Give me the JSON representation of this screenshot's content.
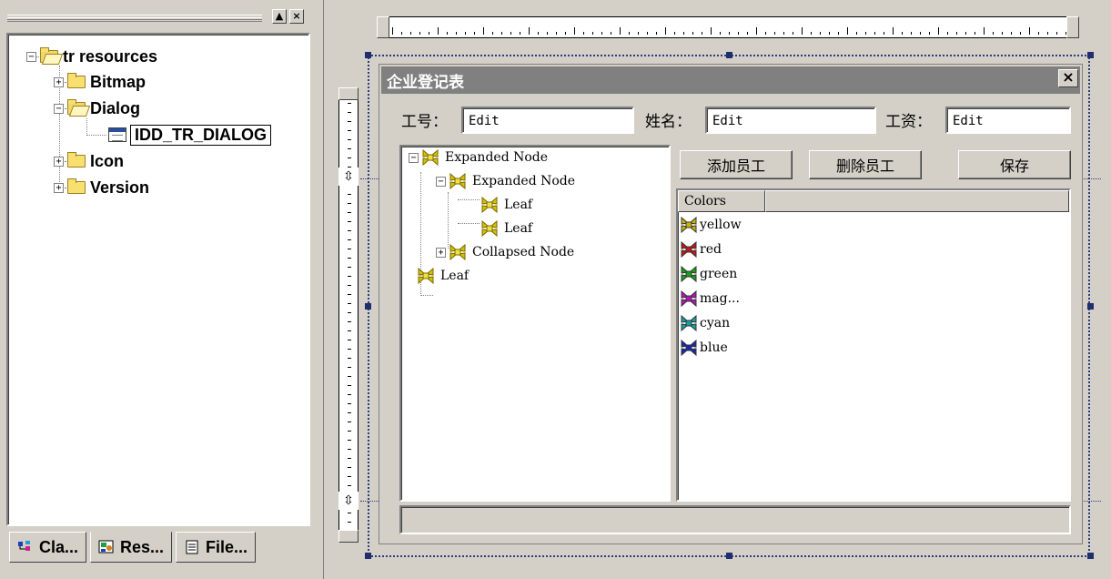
{
  "left_panel": {
    "minimize_glyph": "▲",
    "close_glyph": "×",
    "tree": {
      "root_label": "tr resources",
      "bitmap_label": "Bitmap",
      "dialog_label": "Dialog",
      "dialog_item_label": "IDD_TR_DIALOG",
      "icon_label": "Icon",
      "version_label": "Version",
      "expanded_glyph": "−",
      "collapsed_glyph": "+"
    },
    "tabs": [
      {
        "label": "Cla...",
        "icon": "class-view-icon"
      },
      {
        "label": "Res...",
        "icon": "resource-view-icon"
      },
      {
        "label": "File...",
        "icon": "file-view-icon"
      }
    ]
  },
  "dialog": {
    "title": "企业登记表",
    "close_glyph": "×",
    "fields": {
      "id_label": "工号：",
      "id_value": "Edit",
      "name_label": "姓名：",
      "name_value": "Edit",
      "salary_label": "工资：",
      "salary_value": "Edit"
    },
    "buttons": {
      "add": "添加员工",
      "delete": "删除员工",
      "save": "保存"
    },
    "tree_control": {
      "node1": "Expanded Node",
      "node2": "Expanded Node",
      "leaf1": "Leaf",
      "leaf2": "Leaf",
      "node3": "Collapsed Node",
      "leaf3": "Leaf",
      "expanded_glyph": "−",
      "collapsed_glyph": "+"
    },
    "list_control": {
      "column": "Colors",
      "items": [
        "yellow",
        "red",
        "green",
        "mag...",
        "cyan",
        "blue"
      ],
      "item_colors": [
        "#c8b400",
        "#c81414",
        "#14a014",
        "#b414b4",
        "#14a0a0",
        "#1428b4"
      ]
    }
  },
  "rulers": {
    "v_top_glyph": "⇳",
    "v_bottom_glyph": "⇳"
  }
}
